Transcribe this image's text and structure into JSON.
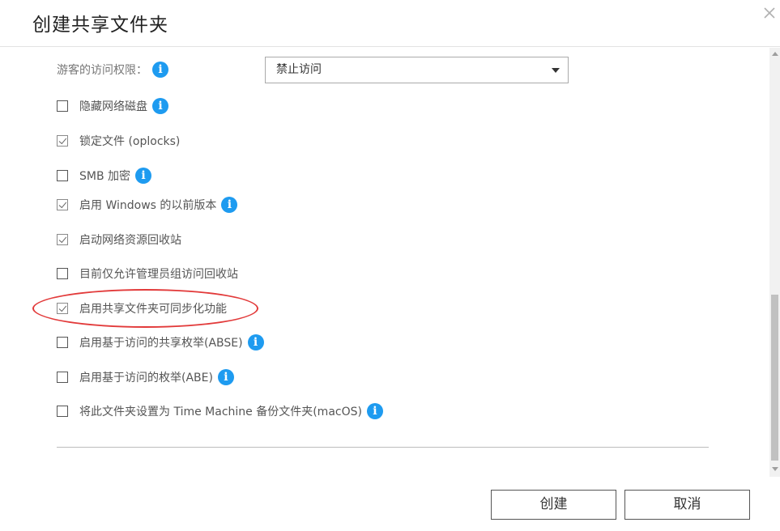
{
  "dialog": {
    "title": "创建共享文件夹"
  },
  "guest_access": {
    "label": "游客的访问权限：",
    "selected": "禁止访问"
  },
  "options": [
    {
      "label": "隐藏网络磁盘",
      "checked": false,
      "info": true
    },
    {
      "label": "锁定文件 (oplocks)",
      "checked": true,
      "info": false
    },
    {
      "label": "SMB 加密",
      "checked": false,
      "info": true
    },
    {
      "label": "启用 Windows 的以前版本",
      "checked": true,
      "info": true
    },
    {
      "label": "启动网络资源回收站",
      "checked": true,
      "info": false
    },
    {
      "label": "目前仅允许管理员组访问回收站",
      "checked": false,
      "info": false
    },
    {
      "label": "启用共享文件夹可同步化功能",
      "checked": true,
      "info": false
    },
    {
      "label": "启用基于访问的共享枚举(ABSE)",
      "checked": false,
      "info": true
    },
    {
      "label": "启用基于访问的枚举(ABE)",
      "checked": false,
      "info": true
    },
    {
      "label": "将此文件夹设置为 Time Machine 备份文件夹(macOS)",
      "checked": false,
      "info": true
    }
  ],
  "info_glyph": "i",
  "buttons": {
    "create": "创建",
    "cancel": "取消"
  },
  "colors": {
    "info_blue": "#1e9bf0",
    "highlight_red": "#e23a3a"
  }
}
